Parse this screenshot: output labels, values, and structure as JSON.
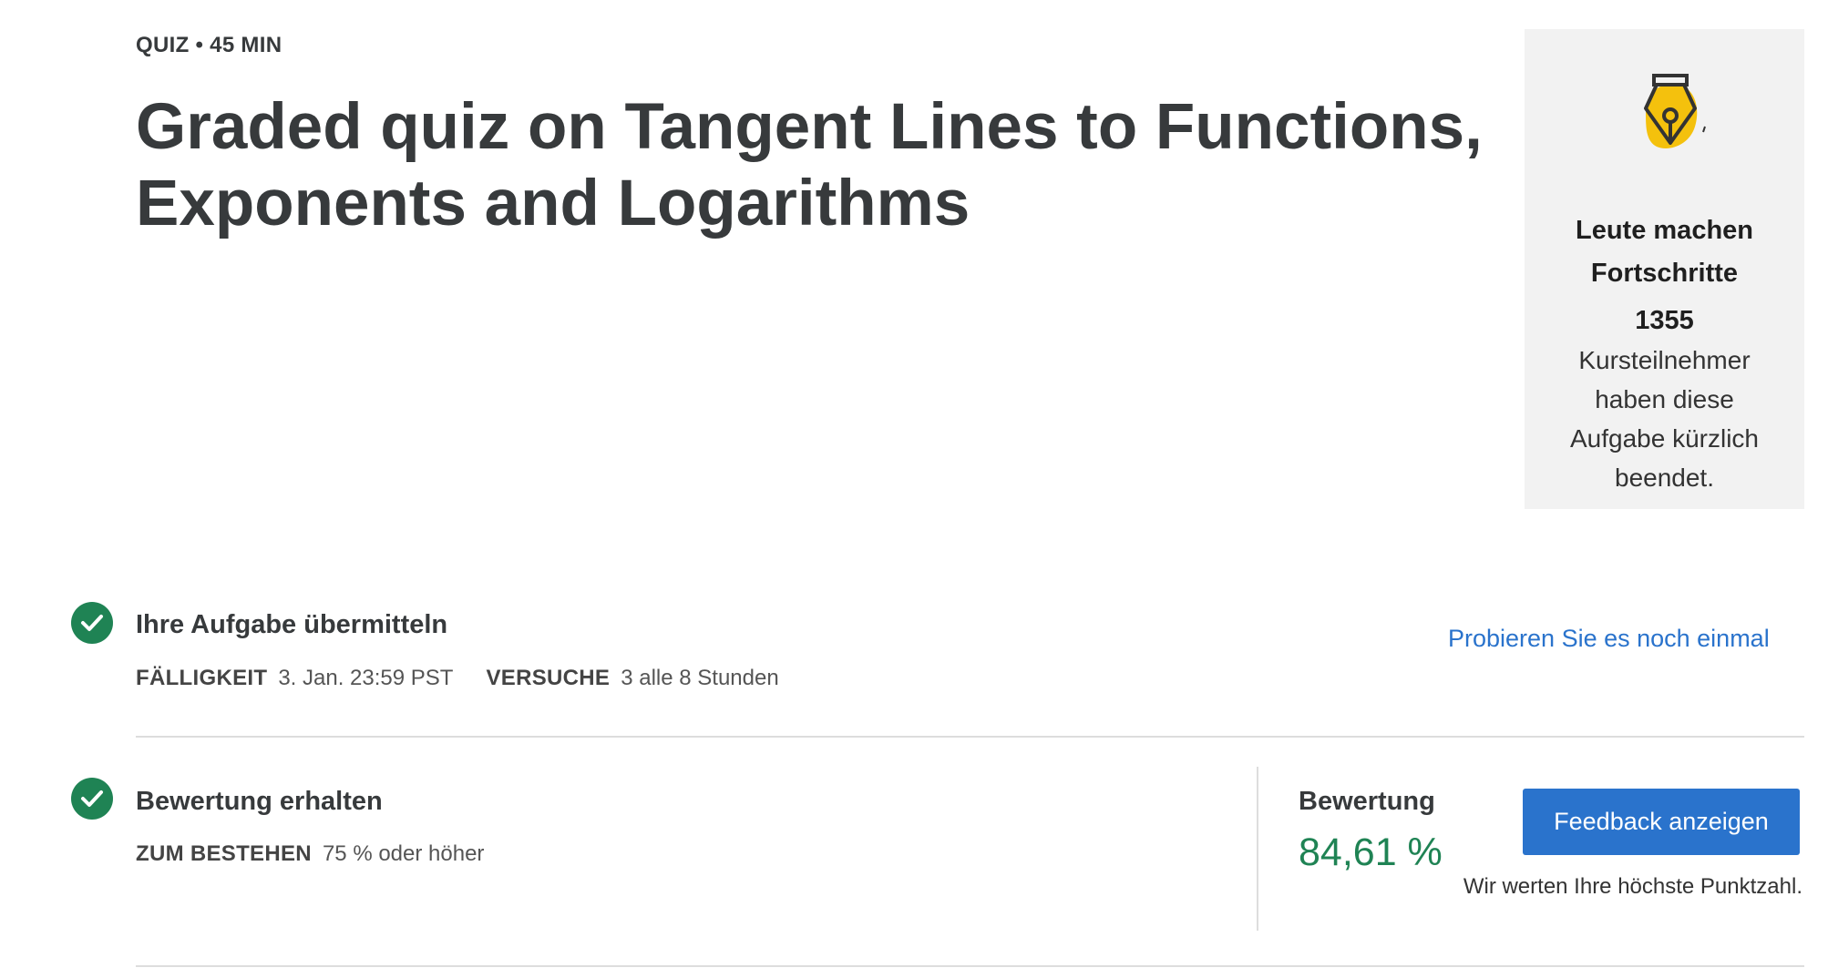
{
  "header": {
    "meta": "QUIZ • 45 MIN",
    "title": "Graded quiz on Tangent Lines to Functions, Exponents and Logarithms"
  },
  "side_card": {
    "icon": "pen-nib-icon",
    "icon_color": "#f4c10d",
    "heading": "Leute machen Fortschritte",
    "count": "1355",
    "text": "Kursteilnehmer haben diese Aufgabe kürzlich beendet."
  },
  "submit_section": {
    "title": "Ihre Aufgabe übermitteln",
    "due_label": "FÄLLIGKEIT",
    "due_value": "3. Jan. 23:59 PST",
    "attempts_label": "VERSUCHE",
    "attempts_value": "3 alle 8 Stunden",
    "retry_link": "Probieren Sie es noch einmal"
  },
  "grade_section": {
    "title": "Bewertung erhalten",
    "pass_label": "ZUM BESTEHEN",
    "pass_value": "75 % oder höher",
    "grade_label": "Bewertung",
    "grade_value": "84,61 %",
    "feedback_button": "Feedback anzeigen",
    "note": "Wir werten Ihre höchste Punktzahl."
  },
  "colors": {
    "accent": "#2a73cc",
    "success": "#1f8354",
    "card_bg": "#f2f2f2"
  }
}
